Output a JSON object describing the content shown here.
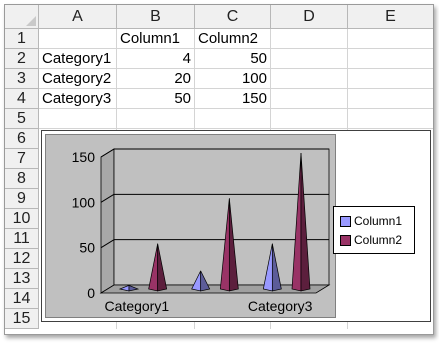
{
  "sheet": {
    "columns": [
      "A",
      "B",
      "C",
      "D",
      "E"
    ],
    "rows": [
      "1",
      "2",
      "3",
      "4",
      "5",
      "6",
      "7",
      "8",
      "9",
      "10",
      "11",
      "12",
      "13",
      "14",
      "15"
    ],
    "cells": [
      [
        "",
        "Column1",
        "Column2",
        "",
        ""
      ],
      [
        "Category1",
        "4",
        "50",
        "",
        ""
      ],
      [
        "Category2",
        "20",
        "100",
        "",
        ""
      ],
      [
        "Category3",
        "50",
        "150",
        "",
        ""
      ]
    ]
  },
  "chart_data": {
    "type": "bar",
    "style": "3d-cone",
    "categories": [
      "Category1",
      "Category2",
      "Category3"
    ],
    "x_tick_labels": [
      "Category1",
      "",
      "Category3"
    ],
    "series": [
      {
        "name": "Column1",
        "values": [
          4,
          20,
          50
        ],
        "color": "#9999ff"
      },
      {
        "name": "Column2",
        "values": [
          50,
          100,
          150
        ],
        "color": "#993366"
      }
    ],
    "ylim": [
      0,
      150
    ],
    "yticks": [
      0,
      50,
      100,
      150
    ],
    "grid": true,
    "legend_position": "right",
    "wall_color": "#c0c0c0",
    "title": "",
    "xlabel": "",
    "ylabel": ""
  }
}
